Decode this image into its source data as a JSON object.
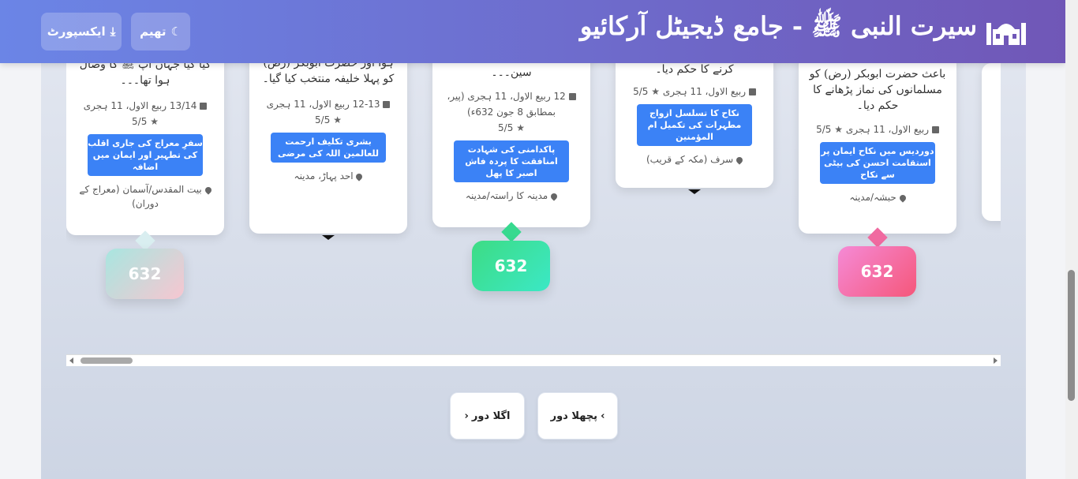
{
  "header": {
    "title": "سیرت النبی ﷺ - جامع ڈیجیٹل آرکائیو",
    "theme_button": "تھیم",
    "export_button": "ایکسپورٹ"
  },
  "cards": [
    {
      "desc": "کیا گیا جہاں آپ ﷺ کا وصال ہوا تھا۔۔۔",
      "date": "13/14 ربیع الاول، 11 ہجری",
      "rating": "5/5",
      "tag": "سفرِ معراج کی جاری اقلب کی تطہیر اور ایمان میں اضافہ",
      "location": "بیت المقدس/آسمان (معراج کے دوران)"
    },
    {
      "desc": "ہوا اور حضرت ابوبکر (رض) کو پہلا خلیفہ منتخب کیا گیا۔",
      "date": "12-13 ربیع الاول، 11 ہجری",
      "rating": "5/5",
      "tag": "بشری تکلیف ارحمت للعالمین اللہ کی مرضی",
      "location": "احد پہاڑ، مدینہ"
    },
    {
      "desc": "(رض) کے تجربے ہیں، انہی کے سین۔۔۔",
      "date": "12 ربیع الاول، 11 ہجری (پیر، بمطابق 8 جون 632ء)",
      "rating": "5/5",
      "tag": "پاکدامنی کی شہادت امنافقت کا پردہ فاش اصبر کا پھل",
      "location": "مدینہ کا راستہ/مدینہ"
    },
    {
      "desc": "کرنے کا حکم دیا۔",
      "date": "ربیع الاول، 11 ہجری",
      "rating": "5/5",
      "tag": "نکاح کا تسلسل ازواج مطہرات کی تکمیل ام المؤمنین",
      "location": "سرف (مکہ کے قریب)"
    },
    {
      "desc": "باعث حضرت ابوبکر (رض) کو مسلمانوں کی نماز پڑھانے کا حکم دیا۔",
      "date": "ربیع الاول، 11 ہجری",
      "rating": "5/5",
      "tag": "دوردیس میں نکاح ایمان پر استقامت احسن کی بیٹی سے نکاح",
      "location": "حبشہ/مدینہ"
    }
  ],
  "years": [
    "632",
    "632",
    "632"
  ],
  "nav": {
    "prev": "پچھلا دور",
    "next": "اگلا دور"
  }
}
